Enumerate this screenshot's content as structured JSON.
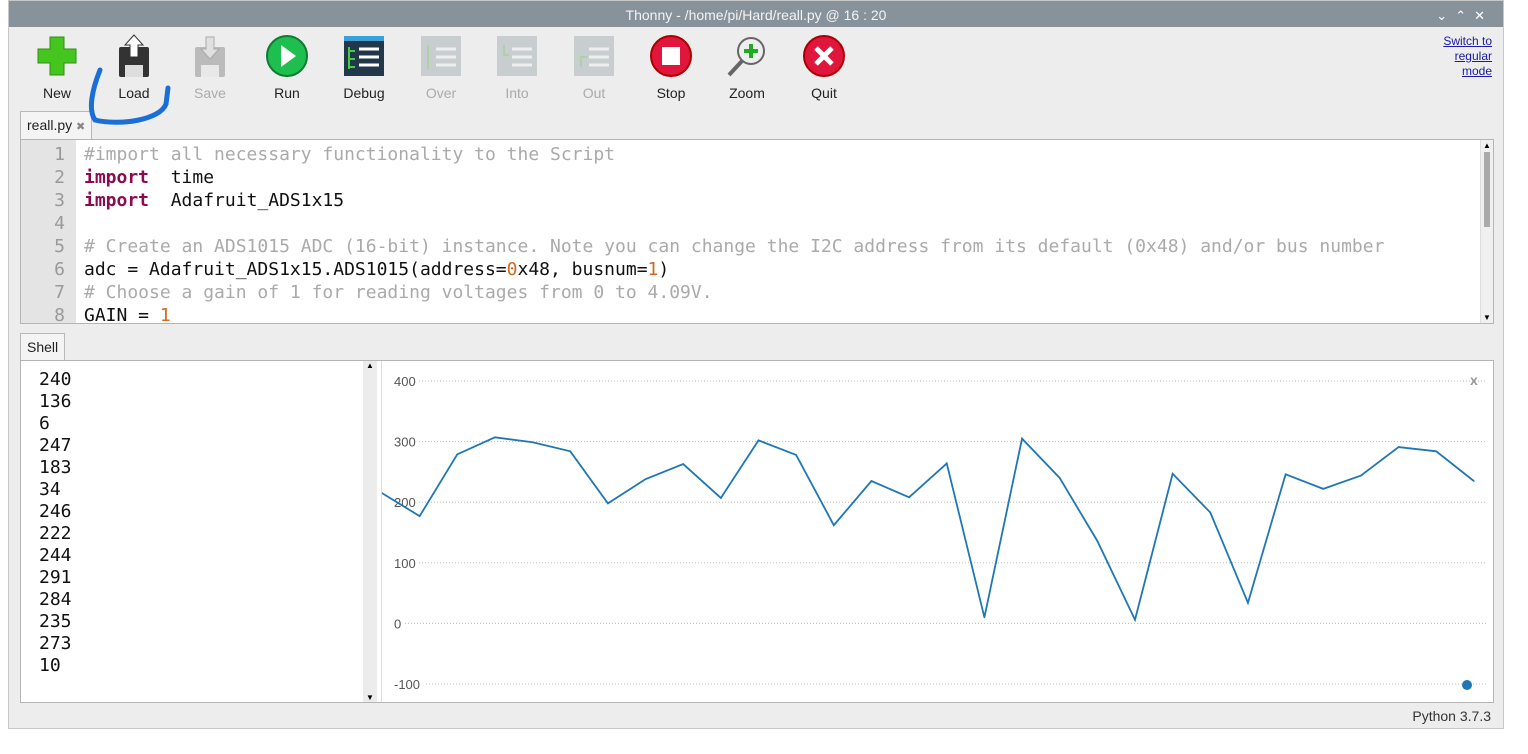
{
  "window": {
    "title": "Thonny  -  /home/pi/Hard/reall.py  @  16 : 20",
    "controls": [
      "⌄",
      "⌃",
      "✕"
    ]
  },
  "toolbar": [
    {
      "label": "New",
      "icon": "plus-icon",
      "enabled": true
    },
    {
      "label": "Load",
      "icon": "load-floppy-icon",
      "enabled": true
    },
    {
      "label": "Save",
      "icon": "save-floppy-icon",
      "enabled": false
    },
    {
      "label": "Run",
      "icon": "play-icon",
      "enabled": true
    },
    {
      "label": "Debug",
      "icon": "debug-icon",
      "enabled": true
    },
    {
      "label": "Over",
      "icon": "step-over-icon",
      "enabled": false
    },
    {
      "label": "Into",
      "icon": "step-into-icon",
      "enabled": false
    },
    {
      "label": "Out",
      "icon": "step-out-icon",
      "enabled": false
    },
    {
      "label": "Stop",
      "icon": "stop-icon",
      "enabled": true
    },
    {
      "label": "Zoom",
      "icon": "zoom-icon",
      "enabled": true
    },
    {
      "label": "Quit",
      "icon": "quit-icon",
      "enabled": true
    }
  ],
  "switch_mode": [
    "Switch to",
    "regular",
    "mode"
  ],
  "editor": {
    "tab": "reall.py",
    "close": "✖",
    "lines": [
      {
        "n": "1",
        "parts": [
          [
            "cm",
            "#import all necessary functionality to the Script"
          ]
        ]
      },
      {
        "n": "2",
        "parts": [
          [
            "kw",
            "import"
          ],
          [
            "",
            "  time"
          ]
        ]
      },
      {
        "n": "3",
        "parts": [
          [
            "kw",
            "import"
          ],
          [
            "",
            "  Adafruit_ADS1x15"
          ]
        ]
      },
      {
        "n": "4",
        "parts": []
      },
      {
        "n": "5",
        "parts": [
          [
            "cm",
            "# Create an ADS1015 ADC (16-bit) instance. Note you can change the I2C address from its default (0x48) and/or bus number"
          ]
        ]
      },
      {
        "n": "6",
        "parts": [
          [
            "",
            "adc = Adafruit_ADS1x15.ADS1015(address="
          ],
          [
            "num",
            "0"
          ],
          [
            "",
            "x48, busnum="
          ],
          [
            "num",
            "1"
          ],
          [
            "",
            ")"
          ]
        ]
      },
      {
        "n": "7",
        "parts": [
          [
            "cm",
            "# Choose a gain of 1 for reading voltages from 0 to 4.09V."
          ]
        ]
      },
      {
        "n": "8",
        "parts": [
          [
            "",
            "GAIN = "
          ],
          [
            "num",
            "1"
          ]
        ]
      }
    ]
  },
  "shell": {
    "tab": "Shell",
    "lines": [
      "240",
      "136",
      "6",
      "247",
      "183",
      "34",
      "246",
      "222",
      "244",
      "291",
      "284",
      "235",
      "273",
      "10"
    ]
  },
  "status": "Python 3.7.3",
  "colors": {
    "series": "#1f77b4",
    "annotation": "#1a6fd6"
  },
  "chart_data": {
    "type": "line",
    "yticks": [
      "400",
      "300",
      "200",
      "100",
      "0",
      "-100"
    ],
    "ylim": [
      -100,
      400
    ],
    "grid": true,
    "legend": "bottom-right",
    "values": [
      215,
      177,
      279,
      307,
      299,
      284,
      198,
      238,
      263,
      207,
      302,
      278,
      162,
      235,
      208,
      264,
      10,
      305,
      240,
      136,
      6,
      247,
      183,
      34,
      246,
      222,
      244,
      291,
      284,
      235
    ],
    "close": "x"
  }
}
